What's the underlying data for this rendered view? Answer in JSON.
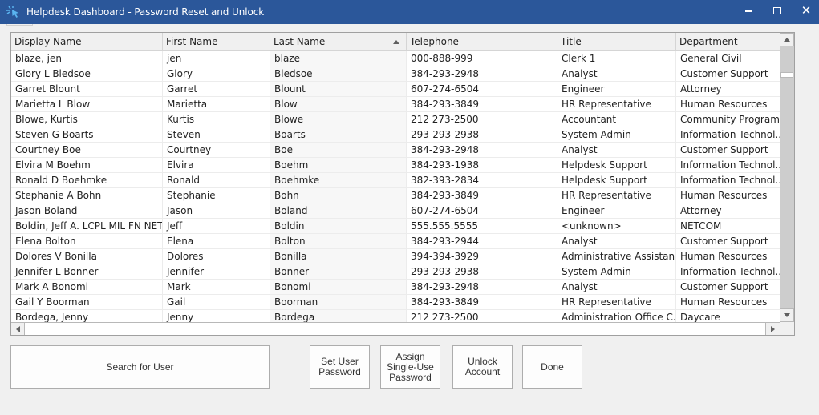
{
  "window": {
    "title": "Helpdesk Dashboard - Password Reset and Unlock",
    "icon": "cursor-click-icon",
    "controls": {
      "minimize": "minimize-icon",
      "maximize": "maximize-icon",
      "close": "close-icon",
      "close_glyph": "✕"
    }
  },
  "grid": {
    "sorted_column": "Last Name",
    "sort_direction": "ascending",
    "columns": [
      "Display Name",
      "First Name",
      "Last Name",
      "Telephone",
      "Title",
      "Department"
    ],
    "rows": [
      [
        "blaze, jen",
        "jen",
        "blaze",
        "000-888-999",
        "Clerk 1",
        "General Civil"
      ],
      [
        "Glory L Bledsoe",
        "Glory",
        "Bledsoe",
        "384-293-2948",
        "Analyst",
        "Customer Support"
      ],
      [
        "Garret Blount",
        "Garret",
        "Blount",
        "607-274-6504",
        "Engineer",
        "Attorney"
      ],
      [
        "Marietta L Blow",
        "Marietta",
        "Blow",
        "384-293-3849",
        "HR Representative",
        "Human Resources"
      ],
      [
        "Blowe, Kurtis",
        "Kurtis",
        "Blowe",
        "212 273-2500",
        "Accountant",
        "Community Programs"
      ],
      [
        "Steven G Boarts",
        "Steven",
        "Boarts",
        "293-293-2938",
        "System Admin",
        "Information Technol..."
      ],
      [
        "Courtney Boe",
        "Courtney",
        "Boe",
        "384-293-2948",
        "Analyst",
        "Customer Support"
      ],
      [
        "Elvira M Boehm",
        "Elvira",
        "Boehm",
        "384-293-1938",
        "Helpdesk Support",
        "Information Technol..."
      ],
      [
        "Ronald D Boehmke",
        "Ronald",
        "Boehmke",
        "382-393-2834",
        "Helpdesk Support",
        "Information Technol..."
      ],
      [
        "Stephanie A Bohn",
        "Stephanie",
        "Bohn",
        "384-293-3849",
        "HR Representative",
        "Human Resources"
      ],
      [
        "Jason Boland",
        "Jason",
        "Boland",
        "607-274-6504",
        "Engineer",
        "Attorney"
      ],
      [
        "Boldin, Jeff A. LCPL MIL FN NET...",
        "Jeff",
        "Boldin",
        "555.555.5555",
        "<unknown>",
        "NETCOM"
      ],
      [
        "Elena Bolton",
        "Elena",
        "Bolton",
        "384-293-2944",
        "Analyst",
        "Customer Support"
      ],
      [
        "Dolores V Bonilla",
        "Dolores",
        "Bonilla",
        "394-394-3929",
        "Administrative Assistant",
        "Human Resources"
      ],
      [
        "Jennifer L Bonner",
        "Jennifer",
        "Bonner",
        "293-293-2938",
        "System Admin",
        "Information Technol..."
      ],
      [
        "Mark A Bonomi",
        "Mark",
        "Bonomi",
        "384-293-2948",
        "Analyst",
        "Customer Support"
      ],
      [
        "Gail Y Boorman",
        "Gail",
        "Boorman",
        "384-293-3849",
        "HR Representative",
        "Human Resources"
      ],
      [
        "Bordega, Jenny",
        "Jenny",
        "Bordega",
        "212 273-2500",
        "Administration Office C...",
        "Daycare"
      ]
    ]
  },
  "buttons": {
    "search": "Search for User",
    "set_password": "Set User\nPassword",
    "assign_single_use": "Assign\nSingle-Use\nPassword",
    "unlock": "Unlock\nAccount",
    "done": "Done"
  },
  "colors": {
    "titlebar": "#2b579a",
    "window_bg": "#f0f0f0",
    "sorted_column_bg": "#f7f7f7"
  }
}
